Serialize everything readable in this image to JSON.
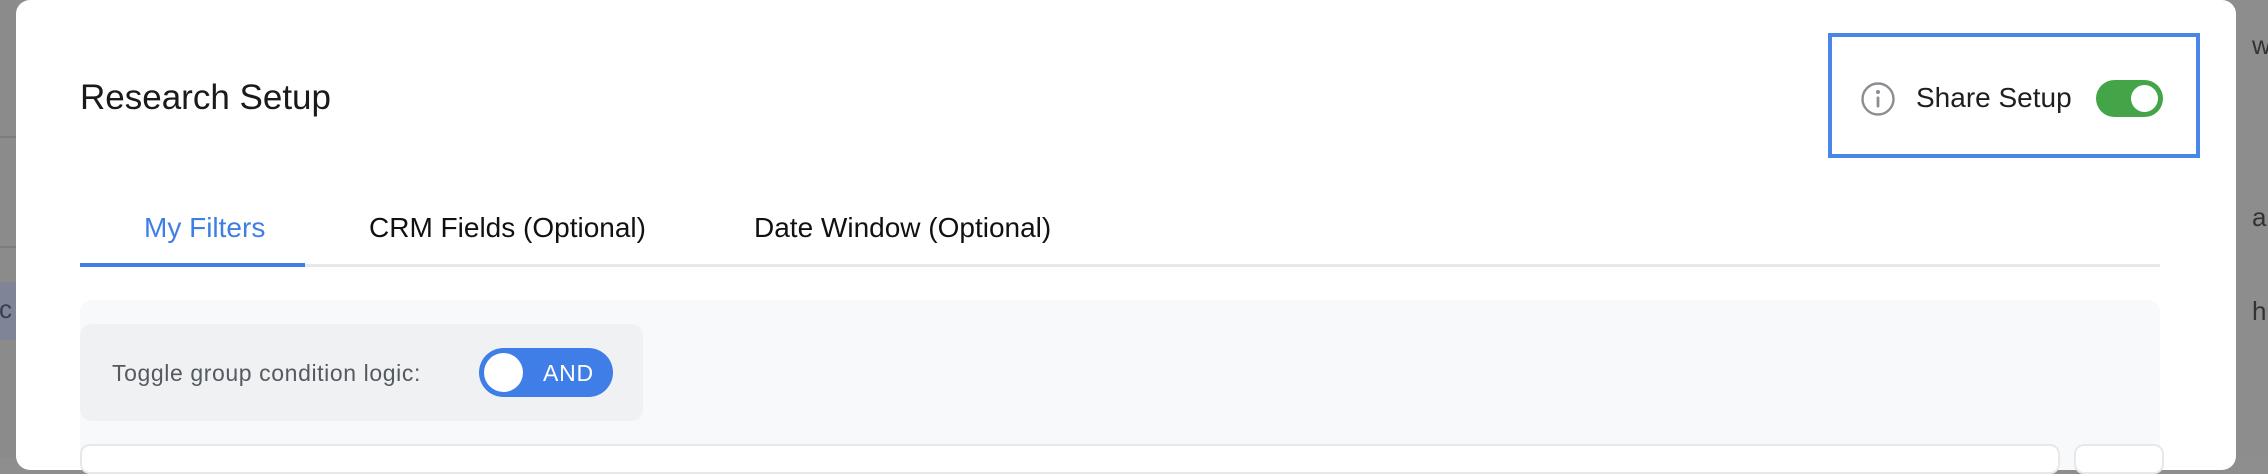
{
  "modal": {
    "title": "Research Setup",
    "share": {
      "label": "Share Setup",
      "enabled": true,
      "toggle_color": "#43a547"
    }
  },
  "tabs": [
    {
      "label": "My Filters",
      "active": true
    },
    {
      "label": "CRM Fields (Optional)",
      "active": false
    },
    {
      "label": "Date Window (Optional)",
      "active": false
    }
  ],
  "filters": {
    "logic_label": "Toggle group condition logic:",
    "logic_value": "AND",
    "accent_color": "#3f7ee6"
  },
  "background": {
    "left_fragment": "cc",
    "right_fragments": [
      "w",
      "a",
      "h"
    ]
  },
  "icons": {
    "info": "info-icon"
  }
}
